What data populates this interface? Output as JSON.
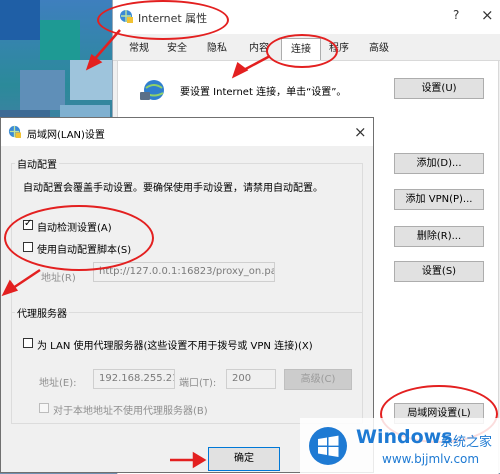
{
  "outer": {
    "title": "Internet 属性",
    "help": "?",
    "close": "×",
    "tabs": [
      "常规",
      "安全",
      "隐私",
      "内容",
      "连接",
      "程序",
      "高级"
    ],
    "setup_text": "要设置 Internet 连接，单击“设置”。",
    "setup_button": "设置(U)",
    "add_button": "添加(D)...",
    "add_vpn_button": "添加 VPN(P)...",
    "delete_button": "删除(R)...",
    "settings_button": "设置(S)",
    "lan_settings_button": "局域网设置(L)"
  },
  "lan": {
    "title": "局域网(LAN)设置",
    "close": "×",
    "auto_group": "自动配置",
    "auto_desc": "自动配置会覆盖手动设置。要确保使用手动设置，请禁用自动配置。",
    "auto_detect": "自动检测设置(A)",
    "auto_script": "使用自动配置脚本(S)",
    "address_label": "地址(R)",
    "script_address": "http://127.0.0.1:16823/proxy_on.pac",
    "proxy_group": "代理服务器",
    "use_proxy": "为 LAN 使用代理服务器(这些设置不用于拨号或 VPN 连接)(X)",
    "proxy_address_label": "地址(E):",
    "proxy_address": "192.168.255.21",
    "port_label": "端口(T):",
    "port": "200",
    "advanced_button": "高级(C)",
    "bypass_local": "对于本地地址不使用代理服务器(B)",
    "ok_button": "确定"
  },
  "watermark": {
    "brand": "Windows",
    "brand_cn": "系统之家",
    "url": "www.bjjmlv.com"
  },
  "colors": {
    "annotation": "#e32020",
    "win_blue": "#1e7ad3"
  }
}
